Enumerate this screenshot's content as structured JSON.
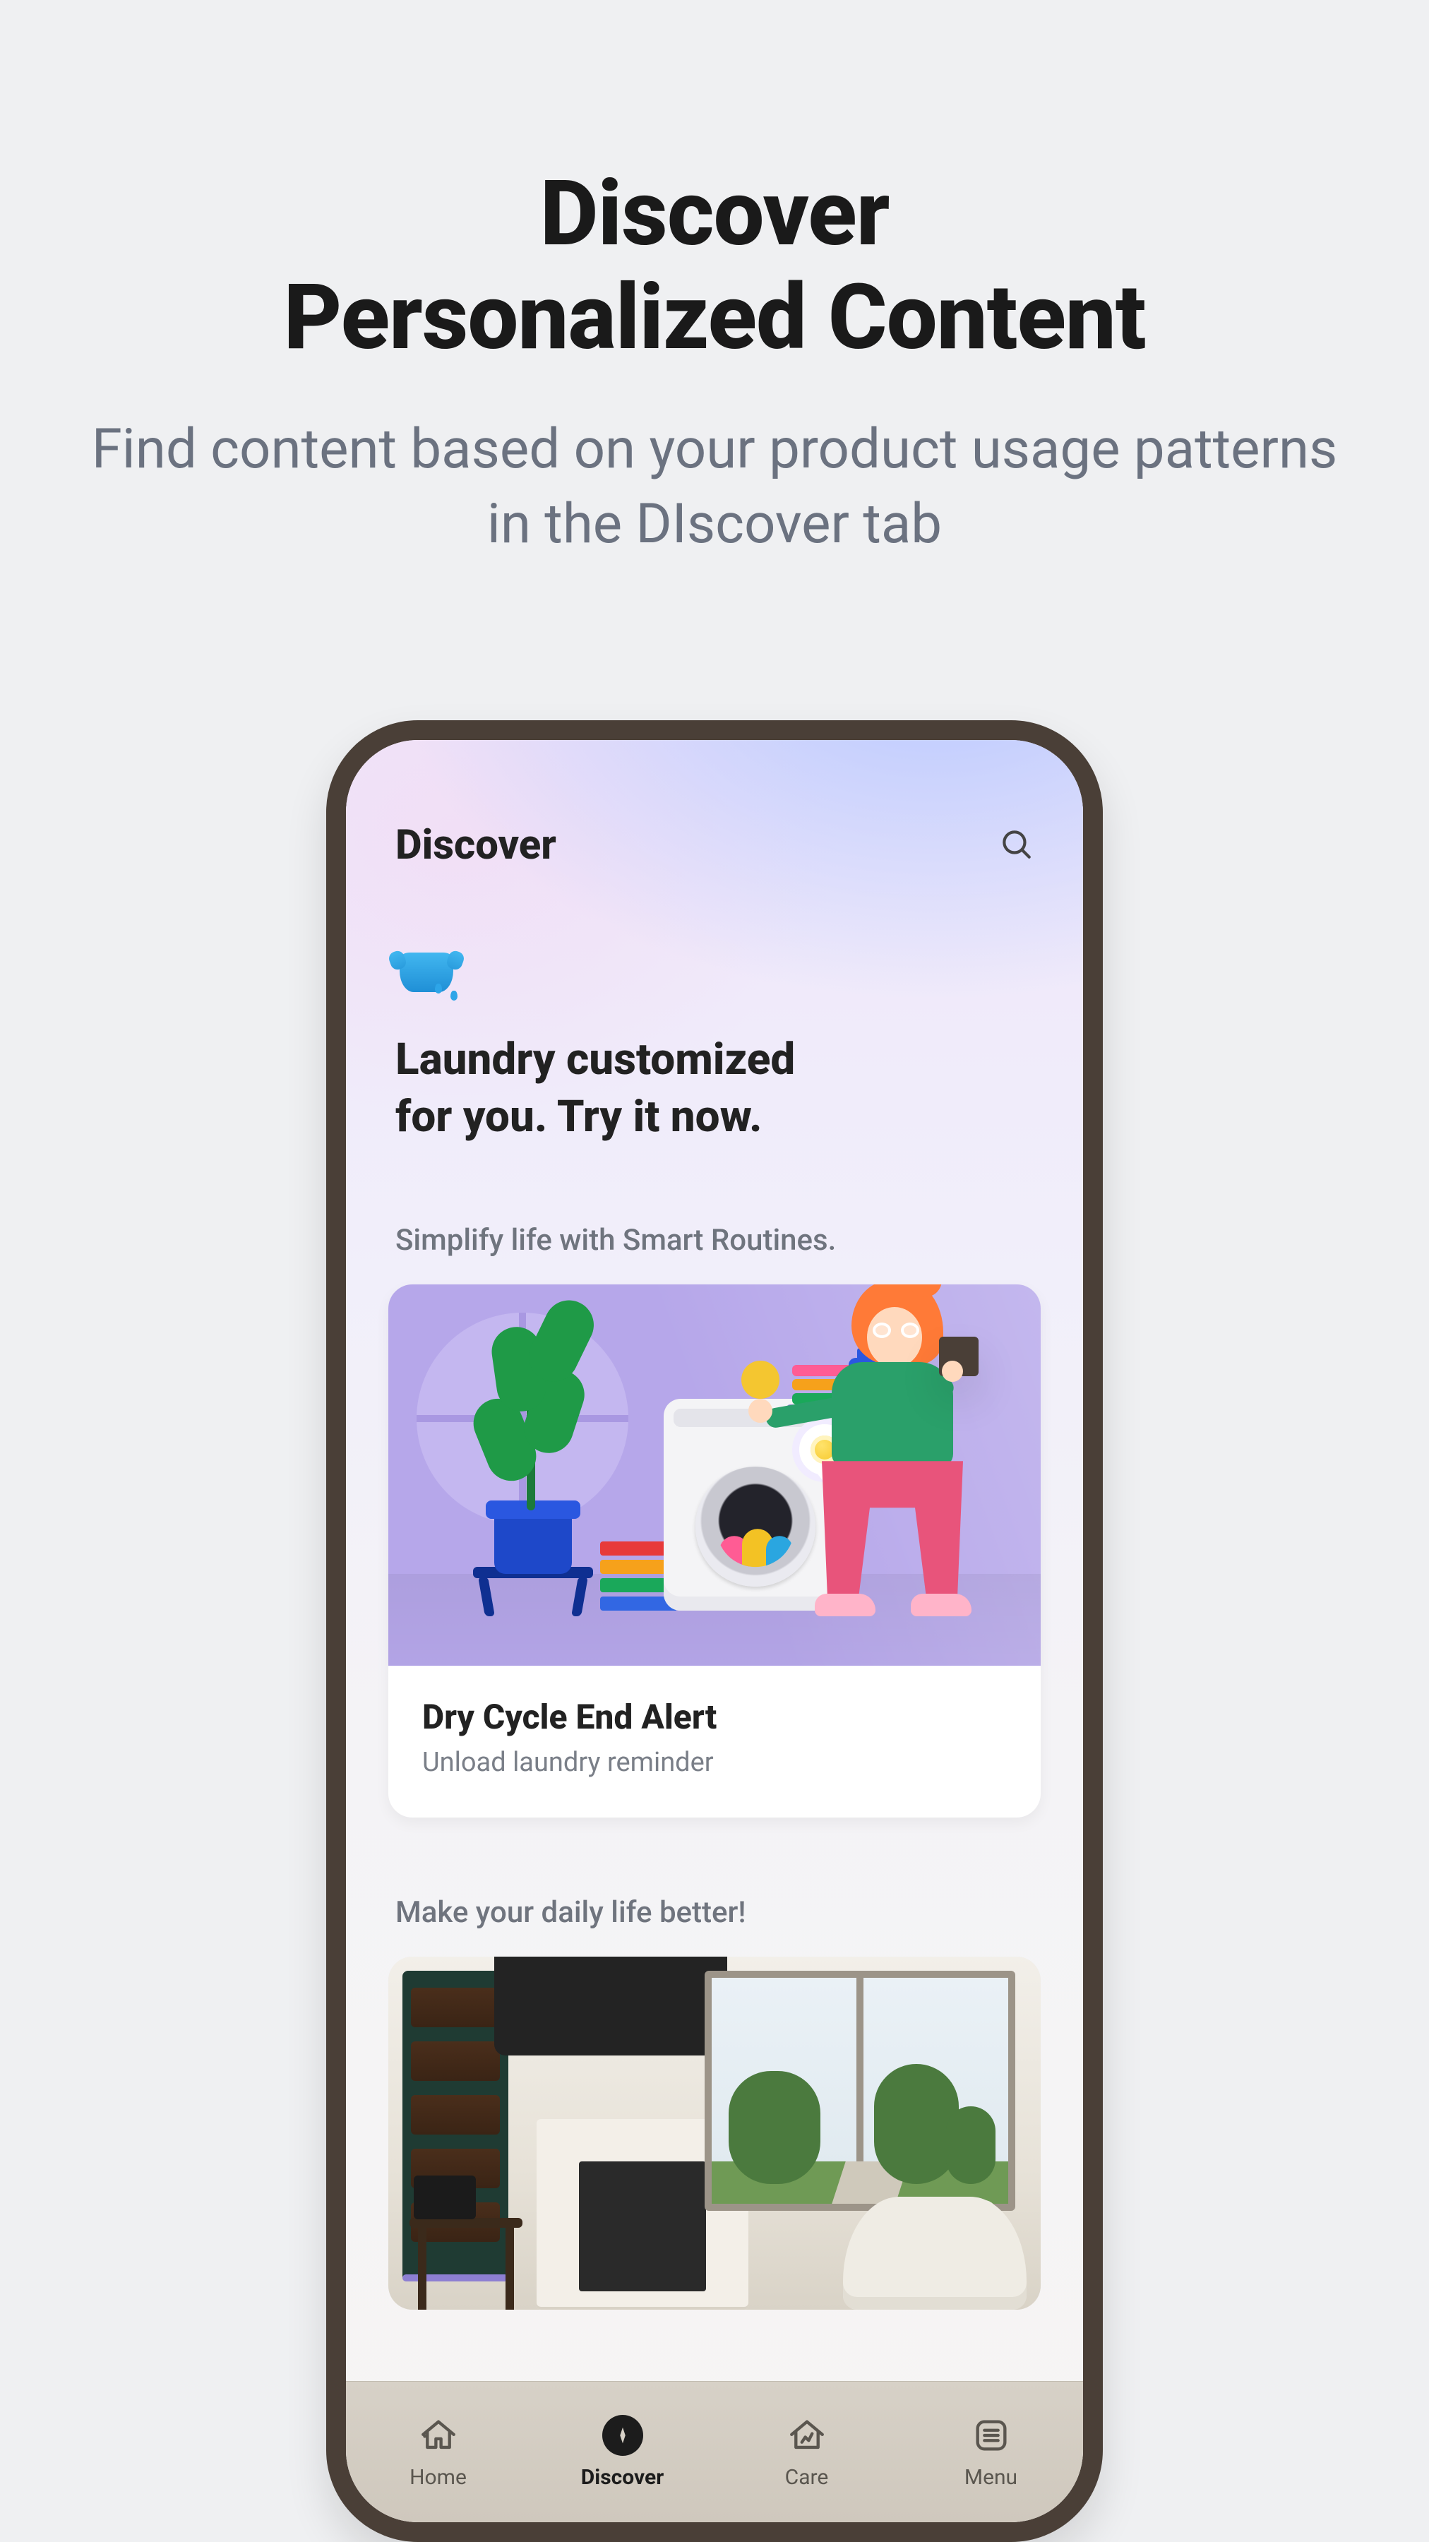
{
  "hero": {
    "title_line1": "Discover",
    "title_line2": "Personalized Content",
    "subtitle": "Find content based on your product usage patterns in the DIscover tab"
  },
  "phone": {
    "header": {
      "title": "Discover",
      "search_icon": "search-icon"
    },
    "feature": {
      "icon": "tshirt-wash-icon",
      "title_line1": "Laundry customized",
      "title_line2": "for you. Try it now."
    },
    "sections": [
      {
        "label": "Simplify life with Smart Routines.",
        "card": {
          "illustration": "laundry-routine-illustration",
          "title": "Dry Cycle End Alert",
          "subtitle": "Unload laundry reminder"
        }
      },
      {
        "label": "Make your daily life better!",
        "card": {
          "image": "living-room-photo"
        }
      }
    ],
    "nav": {
      "items": [
        {
          "key": "home",
          "label": "Home",
          "icon": "home-icon",
          "active": false
        },
        {
          "key": "discover",
          "label": "Discover",
          "icon": "compass-icon",
          "active": true
        },
        {
          "key": "care",
          "label": "Care",
          "icon": "care-icon",
          "active": false
        },
        {
          "key": "menu",
          "label": "Menu",
          "icon": "menu-icon",
          "active": false
        }
      ]
    }
  }
}
